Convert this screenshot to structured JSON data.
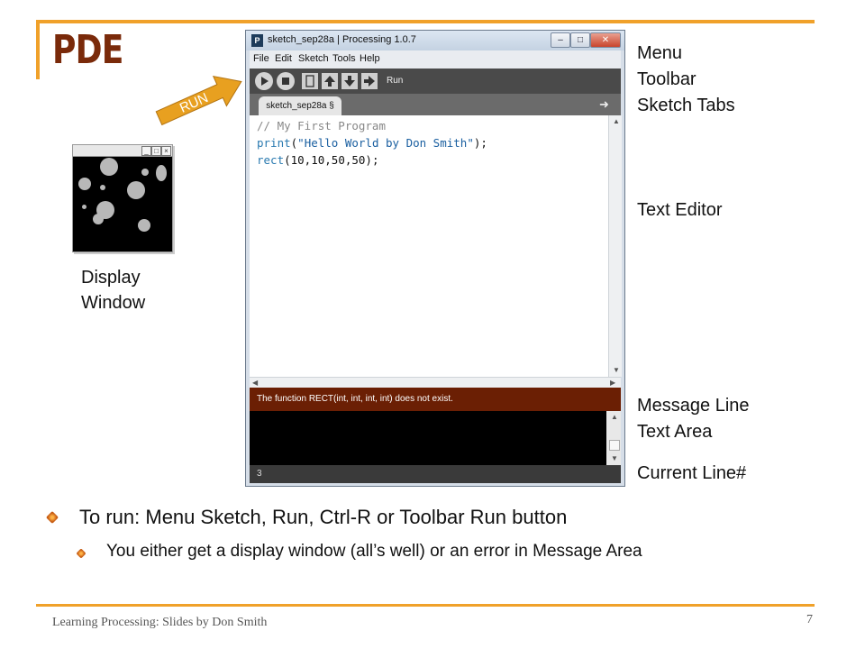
{
  "slide": {
    "title": "PDE",
    "footer": "Learning Processing: Slides by Don Smith",
    "page_number": "7"
  },
  "labels": {
    "menu": "Menu",
    "toolbar": "Toolbar",
    "sketch_tabs": "Sketch Tabs",
    "text_editor": "Text Editor",
    "message_line": "Message Line",
    "text_area": "Text Area",
    "current_line": "Current Line#",
    "display_window_1": "Display",
    "display_window_2": "Window",
    "run_arrow": "RUN"
  },
  "display_window": {
    "buttons": [
      "_",
      "□",
      "×"
    ]
  },
  "processing_window": {
    "title": "sketch_sep28a | Processing 1.0.7",
    "icon_text": "P",
    "window_buttons": [
      "–",
      "□",
      "✕"
    ],
    "menu": [
      "File",
      "Edit",
      "Sketch",
      "Tools",
      "Help"
    ],
    "toolbar_hover_label": "Run",
    "tab": "sketch_sep28a §",
    "tab_menu_arrow": "➜",
    "code": {
      "line1": "// My First Program",
      "line2_fn": "print",
      "line2_open": "(",
      "line2_str": "\"Hello World by Don Smith\"",
      "line2_close": ");",
      "line3_fn": "rect",
      "line3_args": "(10,10,50,50);"
    },
    "message": "The function RECT(int, int, int, int) does not exist.",
    "current_line": "3"
  },
  "bullets": {
    "main": "To run:  Menu Sketch, Run, Ctrl-R or Toolbar Run button",
    "sub": "You either get a display window (all’s well) or an error in Message Area"
  },
  "colors": {
    "accent": "#f0a12a",
    "title": "#7a2a0a",
    "message_bg": "#6b1f04",
    "arrow": "#e8a020"
  }
}
